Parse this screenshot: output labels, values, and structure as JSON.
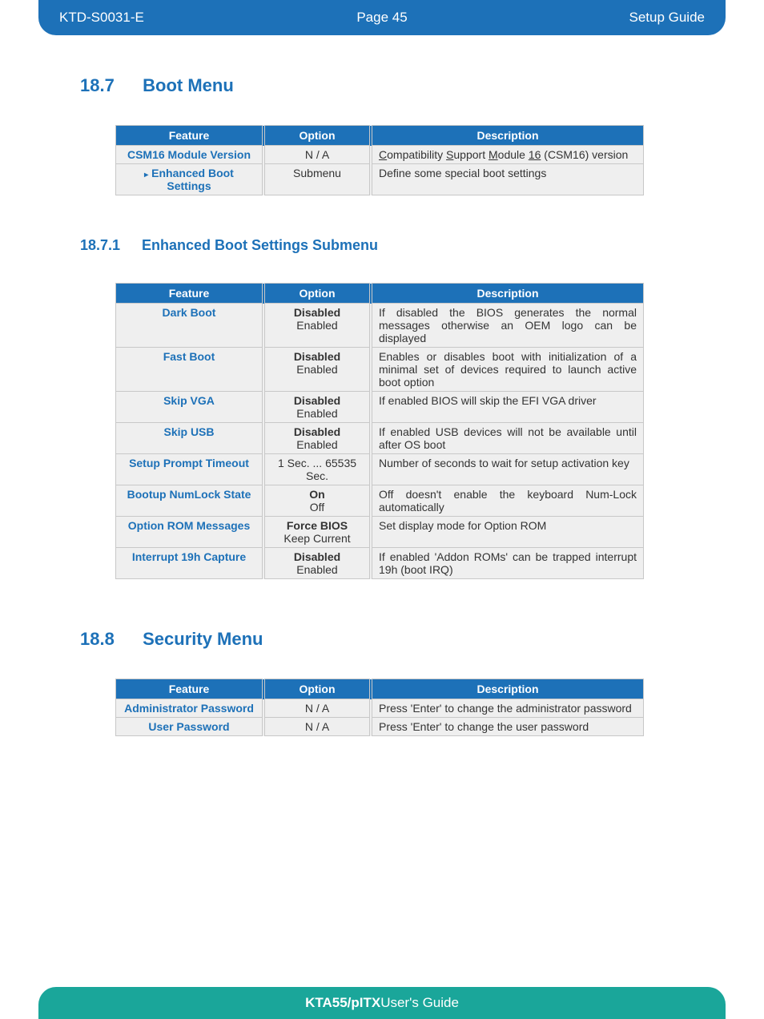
{
  "header": {
    "doc_id": "KTD-S0031-E",
    "page_label": "Page 45",
    "doc_type": "Setup Guide"
  },
  "sections": {
    "boot": {
      "num": "18.7",
      "title": "Boot Menu"
    },
    "enhanced": {
      "num": "18.7.1",
      "title": "Enhanced Boot Settings Submenu"
    },
    "security": {
      "num": "18.8",
      "title": "Security Menu"
    }
  },
  "col_headers": {
    "feature": "Feature",
    "option": "Option",
    "description": "Description"
  },
  "table_boot": [
    {
      "feature": "CSM16 Module Version",
      "option_plain": "N / A",
      "desc_html": "<span class='ul'>C</span>ompatibility <span class='ul'>S</span>upport <span class='ul'>M</span>odule <span class='ul'>16</span> (CSM16) version"
    },
    {
      "feature_html": "<span class='tri'>▸</span>Enhanced Boot<br>Settings",
      "option_plain": "Submenu",
      "desc": "Define some special boot settings"
    }
  ],
  "table_enhanced": [
    {
      "feature": "Dark Boot",
      "opt_bold": "Disabled",
      "opt_plain": "Enabled",
      "desc": "If disabled the BIOS generates the normal messages otherwise an OEM logo can be displayed"
    },
    {
      "feature": "Fast Boot",
      "opt_bold": "Disabled",
      "opt_plain": "Enabled",
      "desc": "Enables or disables boot with initialization of a minimal set of devices required to launch active boot option"
    },
    {
      "feature": "Skip VGA",
      "opt_bold": "Disabled",
      "opt_plain": "Enabled",
      "desc": "If enabled BIOS will skip the EFI VGA driver"
    },
    {
      "feature": "Skip USB",
      "opt_bold": "Disabled",
      "opt_plain": "Enabled",
      "desc": "If enabled USB devices will not be available until after OS boot"
    },
    {
      "feature": "Setup Prompt Timeout",
      "opt_plain_only": "1 Sec. ... 65535 Sec.",
      "desc": "Number of seconds to wait for setup activation key"
    },
    {
      "feature": "Bootup NumLock State",
      "opt_bold": "On",
      "opt_plain": "Off",
      "desc": "Off doesn't enable the keyboard Num-Lock automatically"
    },
    {
      "feature": "Option ROM Messages",
      "opt_bold": "Force BIOS",
      "opt_plain": "Keep Current",
      "desc": "Set display mode for Option ROM"
    },
    {
      "feature": "Interrupt 19h Capture",
      "opt_bold": "Disabled",
      "opt_plain": "Enabled",
      "desc": "If enabled 'Addon ROMs' can be trapped interrupt 19h (boot IRQ)"
    }
  ],
  "table_security": [
    {
      "feature": "Administrator Password",
      "option_plain": "N / A",
      "desc": "Press 'Enter' to change the administrator password"
    },
    {
      "feature": "User Password",
      "option_plain": "N / A",
      "desc": "Press 'Enter' to change the user password"
    }
  ],
  "footer": {
    "product": "KTA55/pITX",
    "suffix": " User's Guide"
  }
}
